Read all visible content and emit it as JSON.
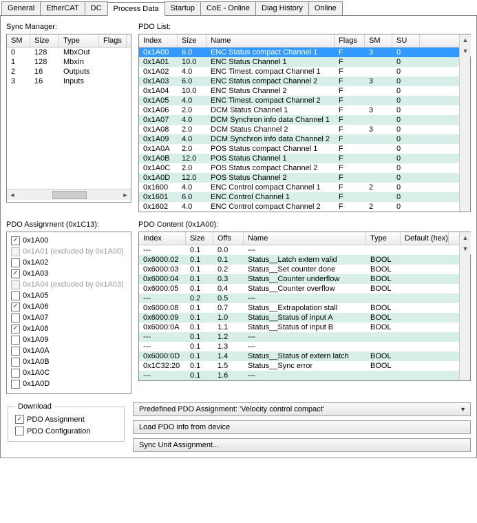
{
  "tabs": [
    "General",
    "EtherCAT",
    "DC",
    "Process Data",
    "Startup",
    "CoE - Online",
    "Diag History",
    "Online"
  ],
  "active_tab": 3,
  "labels": {
    "sync_manager": "Sync Manager:",
    "pdo_list": "PDO List:",
    "pdo_assign": "PDO Assignment (0x1C13):",
    "pdo_content": "PDO Content (0x1A00):",
    "download_legend": "Download",
    "dl_pdo_assign": "PDO Assignment",
    "dl_pdo_config": "PDO Configuration",
    "predef": "Predefined PDO Assignment: 'Velocity control compact'",
    "load_pdo": "Load PDO info from device",
    "sync_unit": "Sync Unit Assignment..."
  },
  "sync_headers": [
    "SM",
    "Size",
    "Type",
    "Flags"
  ],
  "sync_rows": [
    {
      "sm": "0",
      "size": "128",
      "type": "MbxOut",
      "flags": ""
    },
    {
      "sm": "1",
      "size": "128",
      "type": "MbxIn",
      "flags": ""
    },
    {
      "sm": "2",
      "size": "16",
      "type": "Outputs",
      "flags": ""
    },
    {
      "sm": "3",
      "size": "16",
      "type": "Inputs",
      "flags": ""
    }
  ],
  "pdo_headers": [
    "Index",
    "Size",
    "Name",
    "Flags",
    "SM",
    "SU"
  ],
  "pdo_rows": [
    {
      "idx": "0x1A00",
      "size": "6.0",
      "name": "ENC Status compact Channel 1",
      "flags": "F",
      "sm": "3",
      "su": "0",
      "sel": true,
      "alt": false
    },
    {
      "idx": "0x1A01",
      "size": "10.0",
      "name": "ENC Status Channel 1",
      "flags": "F",
      "sm": "",
      "su": "0",
      "alt": true
    },
    {
      "idx": "0x1A02",
      "size": "4.0",
      "name": "ENC Timest. compact Channel 1",
      "flags": "F",
      "sm": "",
      "su": "0",
      "alt": false
    },
    {
      "idx": "0x1A03",
      "size": "6.0",
      "name": "ENC Status compact Channel 2",
      "flags": "F",
      "sm": "3",
      "su": "0",
      "alt": true
    },
    {
      "idx": "0x1A04",
      "size": "10.0",
      "name": "ENC Status Channel 2",
      "flags": "F",
      "sm": "",
      "su": "0",
      "alt": false
    },
    {
      "idx": "0x1A05",
      "size": "4.0",
      "name": "ENC Timest. compact Channel 2",
      "flags": "F",
      "sm": "",
      "su": "0",
      "alt": true
    },
    {
      "idx": "0x1A06",
      "size": "2.0",
      "name": "DCM Status Channel 1",
      "flags": "F",
      "sm": "3",
      "su": "0",
      "alt": false
    },
    {
      "idx": "0x1A07",
      "size": "4.0",
      "name": "DCM Synchron info data Channel 1",
      "flags": "F",
      "sm": "",
      "su": "0",
      "alt": true
    },
    {
      "idx": "0x1A08",
      "size": "2.0",
      "name": "DCM Status Channel 2",
      "flags": "F",
      "sm": "3",
      "su": "0",
      "alt": false
    },
    {
      "idx": "0x1A09",
      "size": "4.0",
      "name": "DCM Synchron info data Channel 2",
      "flags": "F",
      "sm": "",
      "su": "0",
      "alt": true
    },
    {
      "idx": "0x1A0A",
      "size": "2.0",
      "name": "POS Status compact Channel 1",
      "flags": "F",
      "sm": "",
      "su": "0",
      "alt": false
    },
    {
      "idx": "0x1A0B",
      "size": "12.0",
      "name": "POS Status Channel 1",
      "flags": "F",
      "sm": "",
      "su": "0",
      "alt": true
    },
    {
      "idx": "0x1A0C",
      "size": "2.0",
      "name": "POS Status compact Channel 2",
      "flags": "F",
      "sm": "",
      "su": "0",
      "alt": false
    },
    {
      "idx": "0x1A0D",
      "size": "12.0",
      "name": "POS Status Channel 2",
      "flags": "F",
      "sm": "",
      "su": "0",
      "alt": true
    },
    {
      "idx": "0x1600",
      "size": "4.0",
      "name": "ENC Control compact Channel 1",
      "flags": "F",
      "sm": "2",
      "su": "0",
      "alt": false
    },
    {
      "idx": "0x1601",
      "size": "6.0",
      "name": "ENC Control Channel 1",
      "flags": "F",
      "sm": "",
      "su": "0",
      "alt": true
    },
    {
      "idx": "0x1602",
      "size": "4.0",
      "name": "ENC Control compact Channel 2",
      "flags": "F",
      "sm": "2",
      "su": "0",
      "alt": false
    }
  ],
  "assign_rows": [
    {
      "label": "0x1A00",
      "checked": true,
      "disabled": false
    },
    {
      "label": "0x1A01 (excluded by 0x1A00)",
      "checked": false,
      "disabled": true
    },
    {
      "label": "0x1A02",
      "checked": false,
      "disabled": false
    },
    {
      "label": "0x1A03",
      "checked": true,
      "disabled": false
    },
    {
      "label": "0x1A04 (excluded by 0x1A03)",
      "checked": false,
      "disabled": true
    },
    {
      "label": "0x1A05",
      "checked": false,
      "disabled": false
    },
    {
      "label": "0x1A06",
      "checked": true,
      "disabled": false
    },
    {
      "label": "0x1A07",
      "checked": false,
      "disabled": false
    },
    {
      "label": "0x1A08",
      "checked": true,
      "disabled": false
    },
    {
      "label": "0x1A09",
      "checked": false,
      "disabled": false
    },
    {
      "label": "0x1A0A",
      "checked": false,
      "disabled": false
    },
    {
      "label": "0x1A0B",
      "checked": false,
      "disabled": false
    },
    {
      "label": "0x1A0C",
      "checked": false,
      "disabled": false
    },
    {
      "label": "0x1A0D",
      "checked": false,
      "disabled": false
    }
  ],
  "content_headers": [
    "Index",
    "Size",
    "Offs",
    "Name",
    "Type",
    "Default (hex)"
  ],
  "content_rows": [
    {
      "idx": "---",
      "size": "0.1",
      "offs": "0.0",
      "name": "---",
      "type": "",
      "def": "",
      "alt": false
    },
    {
      "idx": "0x6000:02",
      "size": "0.1",
      "offs": "0.1",
      "name": "Status__Latch extern valid",
      "type": "BOOL",
      "def": "",
      "alt": true
    },
    {
      "idx": "0x6000:03",
      "size": "0.1",
      "offs": "0.2",
      "name": "Status__Set counter done",
      "type": "BOOL",
      "def": "",
      "alt": false
    },
    {
      "idx": "0x6000:04",
      "size": "0.1",
      "offs": "0.3",
      "name": "Status__Counter underflow",
      "type": "BOOL",
      "def": "",
      "alt": true
    },
    {
      "idx": "0x6000:05",
      "size": "0.1",
      "offs": "0.4",
      "name": "Status__Counter overflow",
      "type": "BOOL",
      "def": "",
      "alt": false
    },
    {
      "idx": "---",
      "size": "0.2",
      "offs": "0.5",
      "name": "---",
      "type": "",
      "def": "",
      "alt": true
    },
    {
      "idx": "0x6000:08",
      "size": "0.1",
      "offs": "0.7",
      "name": "Status__Extrapolation stall",
      "type": "BOOL",
      "def": "",
      "alt": false
    },
    {
      "idx": "0x6000:09",
      "size": "0.1",
      "offs": "1.0",
      "name": "Status__Status of input A",
      "type": "BOOL",
      "def": "",
      "alt": true
    },
    {
      "idx": "0x6000:0A",
      "size": "0.1",
      "offs": "1.1",
      "name": "Status__Status of input B",
      "type": "BOOL",
      "def": "",
      "alt": false
    },
    {
      "idx": "---",
      "size": "0.1",
      "offs": "1.2",
      "name": "---",
      "type": "",
      "def": "",
      "alt": true
    },
    {
      "idx": "---",
      "size": "0.1",
      "offs": "1.3",
      "name": "---",
      "type": "",
      "def": "",
      "alt": false
    },
    {
      "idx": "0x6000:0D",
      "size": "0.1",
      "offs": "1.4",
      "name": "Status__Status of extern latch",
      "type": "BOOL",
      "def": "",
      "alt": true
    },
    {
      "idx": "0x1C32:20",
      "size": "0.1",
      "offs": "1.5",
      "name": "Status__Sync error",
      "type": "BOOL",
      "def": "",
      "alt": false
    },
    {
      "idx": "---",
      "size": "0.1",
      "offs": "1.6",
      "name": "---",
      "type": "",
      "def": "",
      "alt": true
    }
  ],
  "download": {
    "assign_checked": true,
    "config_checked": false
  }
}
